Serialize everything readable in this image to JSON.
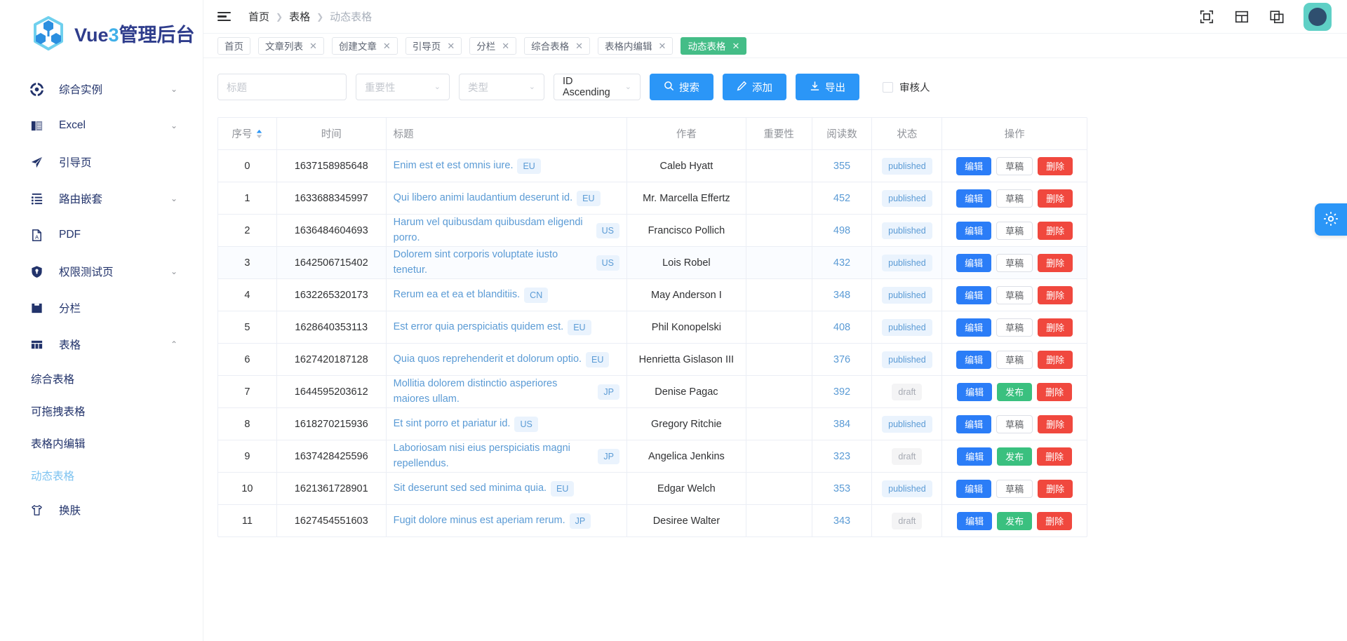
{
  "brand": {
    "name_prefix": "Vue",
    "name_accent": "3",
    "name_suffix": "管理后台",
    "logo_icon": "vue-cube-icon"
  },
  "sidebar": {
    "items": [
      {
        "label": "综合实例",
        "icon": "compass-icon",
        "expandable": true
      },
      {
        "label": "Excel",
        "icon": "book-icon",
        "expandable": true
      },
      {
        "label": "引导页",
        "icon": "paper-plane-icon",
        "expandable": false
      },
      {
        "label": "路由嵌套",
        "icon": "list-icon",
        "expandable": true
      },
      {
        "label": "PDF",
        "icon": "pdf-file-icon",
        "expandable": false
      },
      {
        "label": "权限测试页",
        "icon": "shield-lock-icon",
        "expandable": true
      },
      {
        "label": "分栏",
        "icon": "folder-icon",
        "expandable": false
      },
      {
        "label": "表格",
        "icon": "table-icon",
        "expandable": true,
        "expanded": true
      }
    ],
    "sub_items": [
      {
        "label": "综合表格",
        "active": false
      },
      {
        "label": "可拖拽表格",
        "active": false
      },
      {
        "label": "表格内编辑",
        "active": false
      },
      {
        "label": "动态表格",
        "active": true
      }
    ],
    "footer_item": {
      "label": "换肤",
      "icon": "tshirt-icon"
    }
  },
  "header": {
    "menu_toggle_icon": "hamburger-icon",
    "breadcrumbs": [
      {
        "label": "首页",
        "current": false
      },
      {
        "label": "表格",
        "current": false
      },
      {
        "label": "动态表格",
        "current": true
      }
    ],
    "actions": [
      {
        "icon": "fullscreen-icon"
      },
      {
        "icon": "layout-size-icon"
      },
      {
        "icon": "language-icon"
      }
    ],
    "avatar_icon": "user-avatar"
  },
  "tags": [
    {
      "label": "首页",
      "closable": false,
      "active": false
    },
    {
      "label": "文章列表",
      "closable": true,
      "active": false
    },
    {
      "label": "创建文章",
      "closable": true,
      "active": false
    },
    {
      "label": "引导页",
      "closable": true,
      "active": false
    },
    {
      "label": "分栏",
      "closable": true,
      "active": false
    },
    {
      "label": "综合表格",
      "closable": true,
      "active": false
    },
    {
      "label": "表格内编辑",
      "closable": true,
      "active": false
    },
    {
      "label": "动态表格",
      "closable": true,
      "active": true
    }
  ],
  "toolbar": {
    "title_placeholder": "标题",
    "title_value": "",
    "importance_placeholder": "重要性",
    "type_placeholder": "类型",
    "sort_value": "ID Ascending",
    "search_label": "搜索",
    "search_icon": "search-icon",
    "add_label": "添加",
    "add_icon": "edit-pen-icon",
    "export_label": "导出",
    "export_icon": "download-icon",
    "reviewer_label": "审核人",
    "reviewer_checked": false
  },
  "table": {
    "columns": [
      "序号",
      "时间",
      "标题",
      "作者",
      "重要性",
      "阅读数",
      "状态",
      "操作"
    ],
    "sort_column": "序号",
    "sort_icon": "sort-caret-icon",
    "rows": [
      {
        "idx": "0",
        "time": "1637158985648",
        "title": "Enim est et est omnis iure.",
        "tag": "EU",
        "author": "Caleb Hyatt",
        "importance": "",
        "reads": "355",
        "status": "published",
        "status_type": "published",
        "ops": [
          "编辑",
          "草稿",
          "删除"
        ]
      },
      {
        "idx": "1",
        "time": "1633688345997",
        "title": "Qui libero animi laudantium deserunt id.",
        "tag": "EU",
        "author": "Mr. Marcella Effertz",
        "importance": "",
        "reads": "452",
        "status": "published",
        "status_type": "published",
        "ops": [
          "编辑",
          "草稿",
          "删除"
        ]
      },
      {
        "idx": "2",
        "time": "1636484604693",
        "title": "Harum vel quibusdam quibusdam eligendi porro.",
        "tag": "US",
        "author": "Francisco Pollich",
        "importance": "",
        "reads": "498",
        "status": "published",
        "status_type": "published",
        "ops": [
          "编辑",
          "草稿",
          "删除"
        ]
      },
      {
        "idx": "3",
        "time": "1642506715402",
        "title": "Dolorem sint corporis voluptate iusto tenetur.",
        "tag": "US",
        "author": "Lois Robel",
        "importance": "",
        "reads": "432",
        "status": "published",
        "status_type": "published",
        "ops": [
          "编辑",
          "草稿",
          "删除"
        ]
      },
      {
        "idx": "4",
        "time": "1632265320173",
        "title": "Rerum ea et ea et blanditiis.",
        "tag": "CN",
        "author": "May Anderson I",
        "importance": "",
        "reads": "348",
        "status": "published",
        "status_type": "published",
        "ops": [
          "编辑",
          "草稿",
          "删除"
        ]
      },
      {
        "idx": "5",
        "time": "1628640353113",
        "title": "Est error quia perspiciatis quidem est.",
        "tag": "EU",
        "author": "Phil Konopelski",
        "importance": "",
        "reads": "408",
        "status": "published",
        "status_type": "published",
        "ops": [
          "编辑",
          "草稿",
          "删除"
        ]
      },
      {
        "idx": "6",
        "time": "1627420187128",
        "title": "Quia quos reprehenderit et dolorum optio.",
        "tag": "EU",
        "author": "Henrietta Gislason III",
        "importance": "",
        "reads": "376",
        "status": "published",
        "status_type": "published",
        "ops": [
          "编辑",
          "草稿",
          "删除"
        ]
      },
      {
        "idx": "7",
        "time": "1644595203612",
        "title": "Mollitia dolorem distinctio asperiores maiores ullam.",
        "tag": "JP",
        "author": "Denise Pagac",
        "importance": "",
        "reads": "392",
        "status": "draft",
        "status_type": "draft",
        "ops": [
          "编辑",
          "发布",
          "删除"
        ]
      },
      {
        "idx": "8",
        "time": "1618270215936",
        "title": "Et sint porro et pariatur id.",
        "tag": "US",
        "author": "Gregory Ritchie",
        "importance": "",
        "reads": "384",
        "status": "published",
        "status_type": "published",
        "ops": [
          "编辑",
          "草稿",
          "删除"
        ]
      },
      {
        "idx": "9",
        "time": "1637428425596",
        "title": "Laboriosam nisi eius perspiciatis magni repellendus.",
        "tag": "JP",
        "author": "Angelica Jenkins",
        "importance": "",
        "reads": "323",
        "status": "draft",
        "status_type": "draft",
        "ops": [
          "编辑",
          "发布",
          "删除"
        ]
      },
      {
        "idx": "10",
        "time": "1621361728901",
        "title": "Sit deserunt sed sed minima quia.",
        "tag": "EU",
        "author": "Edgar Welch",
        "importance": "",
        "reads": "353",
        "status": "published",
        "status_type": "published",
        "ops": [
          "编辑",
          "草稿",
          "删除"
        ]
      },
      {
        "idx": "11",
        "time": "1627454551603",
        "title": "Fugit dolore minus est aperiam rerum.",
        "tag": "JP",
        "author": "Desiree Walter",
        "importance": "",
        "reads": "343",
        "status": "draft",
        "status_type": "draft",
        "ops": [
          "编辑",
          "发布",
          "删除"
        ]
      }
    ]
  },
  "fab": {
    "icon": "gear-icon"
  },
  "colors": {
    "primary": "#2b96f7",
    "active_tag": "#44bd87",
    "danger": "#f0483e",
    "success": "#3ac07f",
    "brand_dark": "#2f3d8c",
    "brand_light": "#41b0e8",
    "link": "#5b9bd5"
  }
}
